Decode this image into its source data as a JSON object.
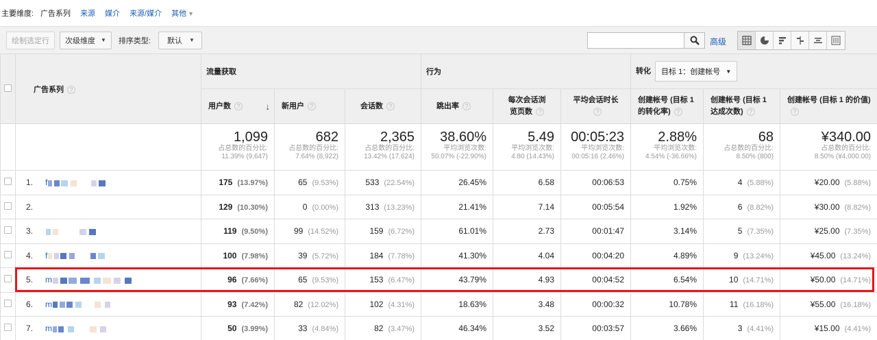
{
  "dimension_bar": {
    "label": "主要维度:",
    "current": "广告系列",
    "options": [
      "来源",
      "媒介",
      "来源/媒介"
    ],
    "more": "其他"
  },
  "toolbar": {
    "plot_rows": "绘制选定行",
    "secondary_dimension": "次级维度",
    "sort_type_label": "排序类型:",
    "sort_type_value": "默认",
    "search_placeholder": "",
    "advanced": "高级"
  },
  "groups": {
    "acquisition": "流量获取",
    "behavior": "行为",
    "conversions": "转化",
    "goal_select": "目标 1：创建帐号"
  },
  "columns": {
    "campaign": "广告系列",
    "users": "用户数",
    "new_users": "新用户",
    "sessions": "会话数",
    "bounce_rate": "跳出率",
    "pages_per_session": "每次会话浏览页数",
    "avg_duration": "平均会话时长",
    "conv_rate": "创建帐号 (目标 1 的转化率)",
    "completions": "创建帐号 (目标 1 达成次数)",
    "value": "创建帐号 (目标 1 的价值)"
  },
  "totals": [
    {
      "big": "1,099",
      "l1": "占总数的百分比:",
      "l2": "11.39% (9,647)"
    },
    {
      "big": "682",
      "l1": "占总数的百分比:",
      "l2": "7.64% (8,922)"
    },
    {
      "big": "2,365",
      "l1": "占总数的百分比:",
      "l2": "13.42% (17,624)"
    },
    {
      "big": "38.60%",
      "l1": "平均浏览次数:",
      "l2": "50.07% (-22.90%)"
    },
    {
      "big": "5.49",
      "l1": "平均浏览次数:",
      "l2": "4.80 (14.43%)"
    },
    {
      "big": "00:05:23",
      "l1": "平均浏览次数:",
      "l2": "00:05:16 (2.46%)"
    },
    {
      "big": "2.88%",
      "l1": "平均浏览次数:",
      "l2": "4.54% (-36.66%)"
    },
    {
      "big": "68",
      "l1": "占总数的百分比:",
      "l2": "8.50% (800)"
    },
    {
      "big": "¥340.00",
      "l1": "占总数的百分比:",
      "l2": "8.50% (¥4,000.00)"
    }
  ],
  "rows": [
    {
      "idx": "1.",
      "name": "f",
      "users": "175",
      "users_pct": "(13.97%)",
      "new_users": "65",
      "new_users_pct": "(9.53%)",
      "sessions": "533",
      "sessions_pct": "(22.54%)",
      "bounce": "26.45%",
      "pages": "6.58",
      "duration": "00:06:53",
      "conv_rate": "0.75%",
      "completions": "4",
      "completions_pct": "(5.88%)",
      "value": "¥20.00",
      "value_pct": "(5.88%)"
    },
    {
      "idx": "2.",
      "name": "",
      "users": "129",
      "users_pct": "(10.30%)",
      "new_users": "0",
      "new_users_pct": "(0.00%)",
      "sessions": "313",
      "sessions_pct": "(13.23%)",
      "bounce": "21.41%",
      "pages": "7.14",
      "duration": "00:05:54",
      "conv_rate": "1.92%",
      "completions": "6",
      "completions_pct": "(8.82%)",
      "value": "¥30.00",
      "value_pct": "(8.82%)"
    },
    {
      "idx": "3.",
      "name": "",
      "users": "119",
      "users_pct": "(9.50%)",
      "new_users": "99",
      "new_users_pct": "(14.52%)",
      "sessions": "159",
      "sessions_pct": "(6.72%)",
      "bounce": "61.01%",
      "pages": "2.73",
      "duration": "00:01:47",
      "conv_rate": "3.14%",
      "completions": "5",
      "completions_pct": "(7.35%)",
      "value": "¥25.00",
      "value_pct": "(7.35%)"
    },
    {
      "idx": "4.",
      "name": "f",
      "users": "100",
      "users_pct": "(7.98%)",
      "new_users": "39",
      "new_users_pct": "(5.72%)",
      "sessions": "184",
      "sessions_pct": "(7.78%)",
      "bounce": "41.30%",
      "pages": "4.04",
      "duration": "00:04:20",
      "conv_rate": "4.89%",
      "completions": "9",
      "completions_pct": "(13.24%)",
      "value": "¥45.00",
      "value_pct": "(13.24%)"
    },
    {
      "idx": "5.",
      "name": "m",
      "users": "96",
      "users_pct": "(7.66%)",
      "new_users": "65",
      "new_users_pct": "(9.53%)",
      "sessions": "153",
      "sessions_pct": "(6.47%)",
      "bounce": "43.79%",
      "pages": "4.93",
      "duration": "00:04:52",
      "conv_rate": "6.54%",
      "completions": "10",
      "completions_pct": "(14.71%)",
      "value": "¥50.00",
      "value_pct": "(14.71%)"
    },
    {
      "idx": "6.",
      "name": "m",
      "users": "93",
      "users_pct": "(7.42%)",
      "new_users": "82",
      "new_users_pct": "(12.02%)",
      "sessions": "102",
      "sessions_pct": "(4.31%)",
      "bounce": "18.63%",
      "pages": "3.48",
      "duration": "00:00:32",
      "conv_rate": "10.78%",
      "completions": "11",
      "completions_pct": "(16.18%)",
      "value": "¥55.00",
      "value_pct": "(16.18%)"
    },
    {
      "idx": "7.",
      "name": "m",
      "users": "50",
      "users_pct": "(3.99%)",
      "new_users": "33",
      "new_users_pct": "(4.84%)",
      "sessions": "82",
      "sessions_pct": "(3.47%)",
      "bounce": "46.34%",
      "pages": "3.52",
      "duration": "00:03:57",
      "conv_rate": "3.66%",
      "completions": "3",
      "completions_pct": "(4.41%)",
      "value": "¥15.00",
      "value_pct": "(4.41%)"
    }
  ],
  "blur_colors": [
    "#6f8fd0",
    "#3a5fb8",
    "#9cc7ec",
    "#f3d9c4",
    "#c9c1e0",
    "#1f4aa8"
  ],
  "highlight_color": "#e8141a"
}
